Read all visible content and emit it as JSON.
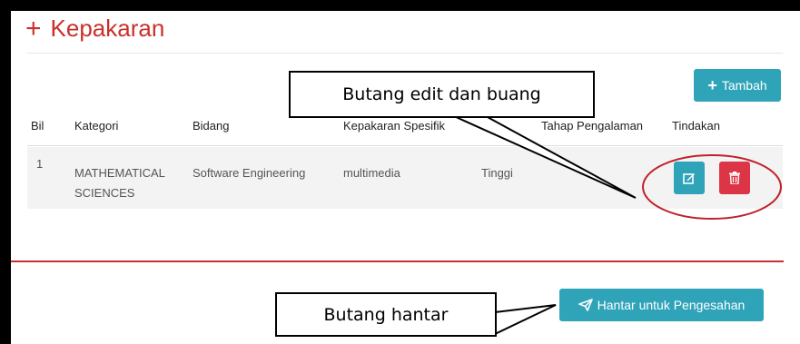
{
  "section": {
    "icon": "plus-icon",
    "title": "Kepakaran"
  },
  "toolbar": {
    "add_label": "Tambah",
    "add_icon": "plus-icon"
  },
  "table": {
    "headers": [
      "Bil",
      "Kategori",
      "Bidang",
      "Kepakaran Spesifik",
      "Tahap Pengalaman",
      "Tindakan"
    ],
    "rows": [
      {
        "bil": "1",
        "kategori_line1": "MATHEMATICAL",
        "kategori_line2": "SCIENCES",
        "bidang": "Software Engineering",
        "kepakaran": "multimedia",
        "tahap": "Tinggi"
      }
    ],
    "actions": {
      "edit_icon": "edit-icon",
      "delete_icon": "trash-icon"
    }
  },
  "submit": {
    "label": "Hantar untuk Pengesahan",
    "icon": "paper-plane-icon"
  },
  "annotations": {
    "edit_delete": "Butang edit dan buang",
    "submit": "Butang hantar"
  },
  "colors": {
    "accent": "#2fa4b9",
    "danger": "#dc3545",
    "title_red": "#c9302c"
  }
}
